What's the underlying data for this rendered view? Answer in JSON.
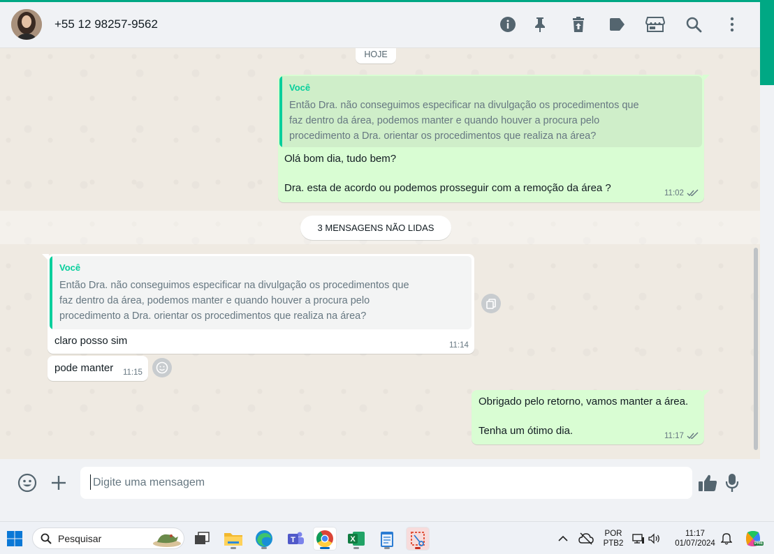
{
  "header": {
    "contact_name": "+55 12 98257-9562",
    "icons": [
      "info-icon",
      "pin-icon",
      "delete-icon",
      "label-icon",
      "store-icon",
      "search-icon",
      "more-icon"
    ]
  },
  "chat": {
    "date_chip": "HOJE",
    "unread_divider": "3 MENSAGENS NÃO LIDAS",
    "messages": [
      {
        "direction": "outgoing",
        "quote_author": "Você",
        "quote_text": "Então Dra. não conseguimos especificar na divulgação os procedimentos que\nfaz dentro da área, podemos manter e quando houver a procura pelo\nprocedimento a Dra. orientar os procedimentos que realiza na área?",
        "text": "Olá bom dia, tudo bem?\n\nDra. esta de acordo ou podemos prosseguir com a remoção da área ?",
        "time": "11:02"
      },
      {
        "direction": "incoming",
        "quote_author": "Você",
        "quote_text": "Então Dra. não conseguimos especificar na divulgação os procedimentos que\nfaz dentro da área, podemos manter e quando houver a procura pelo\nprocedimento a Dra. orientar os procedimentos que realiza na área?",
        "text": "claro posso sim",
        "time": "11:14"
      },
      {
        "direction": "incoming",
        "text": "pode manter",
        "time": "11:15"
      },
      {
        "direction": "outgoing",
        "text": "Obrigado pelo retorno, vamos manter a área.\n\nTenha um ótimo dia.",
        "time": "11:17"
      }
    ]
  },
  "composer": {
    "placeholder": "Digite uma mensagem"
  },
  "taskbar": {
    "search_label": "Pesquisar",
    "language_line1": "POR",
    "language_line2": "PTB2",
    "clock_time": "11:17",
    "clock_date": "01/07/2024",
    "copilot_badge": "PRE"
  },
  "colors": {
    "accent": "#00a884",
    "outgoing_bubble": "#d9fdd3",
    "incoming_bubble": "#ffffff",
    "quote_author": "#06cf9c",
    "chat_background": "#efeae2"
  }
}
